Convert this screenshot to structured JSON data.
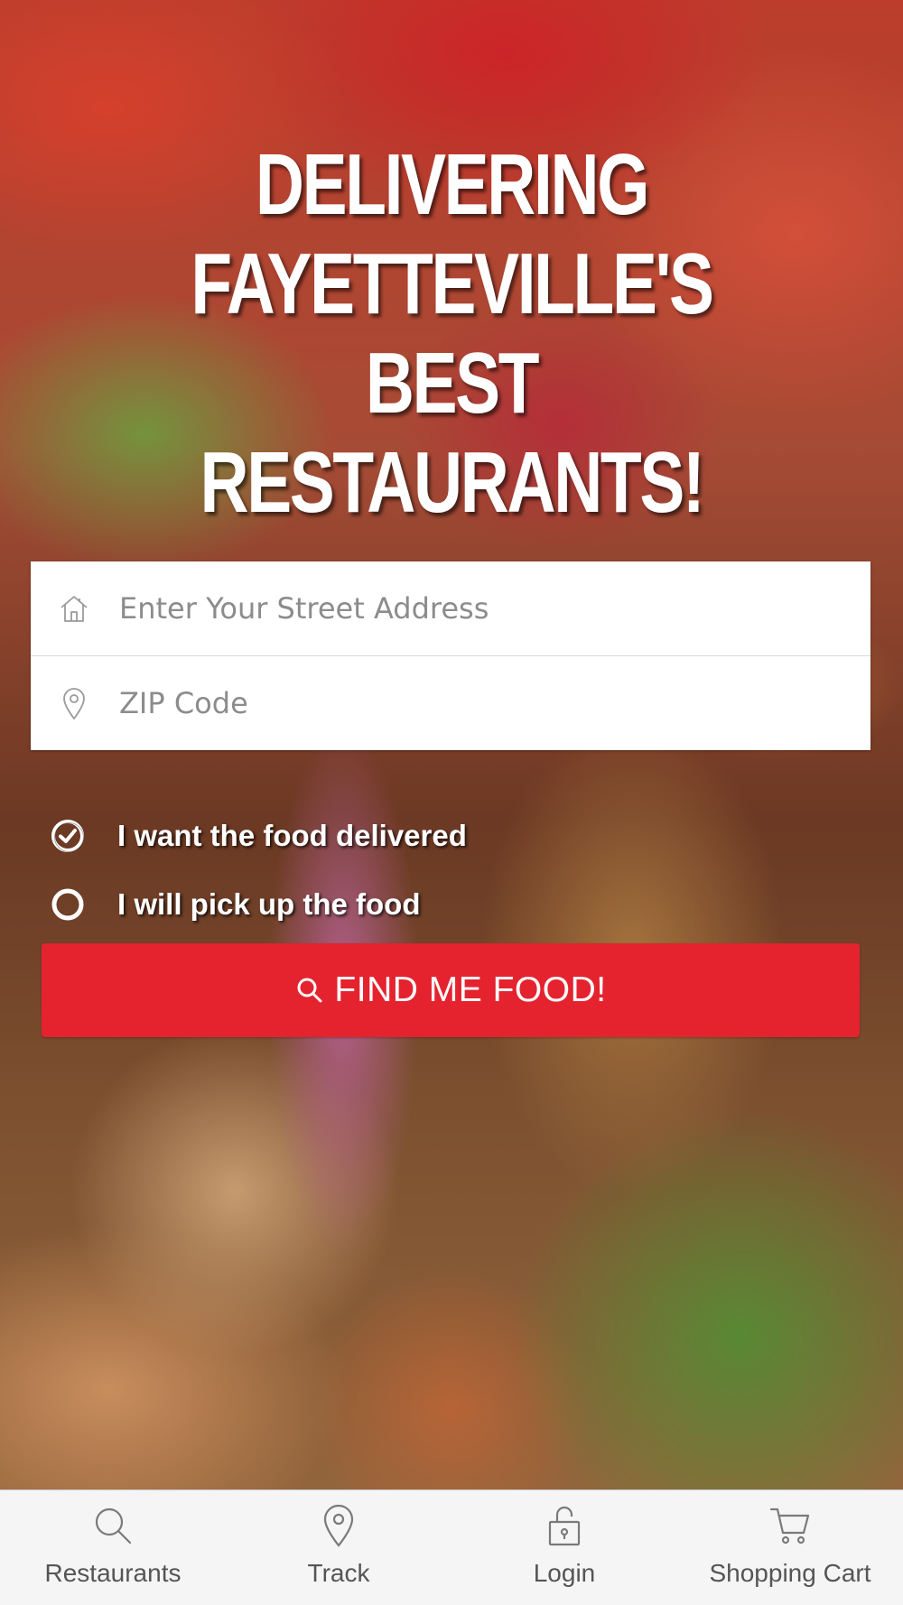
{
  "hero": {
    "headline_lines": [
      "DELIVERING",
      "FAYETTEVILLE'S BEST",
      "RESTAURANTS!"
    ]
  },
  "address_form": {
    "street": {
      "icon": "home-icon",
      "placeholder": "Enter Your Street Address",
      "value": ""
    },
    "zip": {
      "icon": "location-pin-icon",
      "placeholder": "ZIP Code",
      "value": ""
    }
  },
  "options": [
    {
      "label": "I want the food delivered",
      "selected": true,
      "icon": "check-circle-icon"
    },
    {
      "label": "I will pick up the food",
      "selected": false,
      "icon": "empty-circle-icon"
    }
  ],
  "cta": {
    "label": "FIND ME FOOD!",
    "icon": "search-icon",
    "color": "#e4232f"
  },
  "tabbar": {
    "items": [
      {
        "label": "Restaurants",
        "icon": "search-icon"
      },
      {
        "label": "Track",
        "icon": "location-pin-icon"
      },
      {
        "label": "Login",
        "icon": "unlock-icon"
      },
      {
        "label": "Shopping Cart",
        "icon": "cart-icon"
      }
    ]
  }
}
